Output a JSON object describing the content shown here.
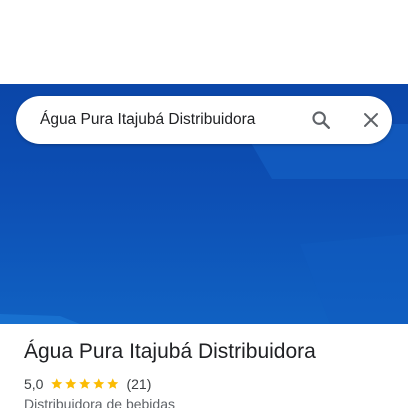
{
  "search": {
    "query": "Água Pura Itajubá Distribuidora",
    "search_icon": "search-icon",
    "clear_icon": "close-icon"
  },
  "place": {
    "name": "Água Pura Itajubá Distribuidora",
    "rating": "5,0",
    "stars": 5,
    "review_count": "(21)",
    "category": "Distribuidora de bebidas"
  },
  "colors": {
    "hero_blue": "#0d4fb4",
    "star": "#fbbc04",
    "text_primary": "#202124",
    "text_secondary": "#5f6368"
  }
}
